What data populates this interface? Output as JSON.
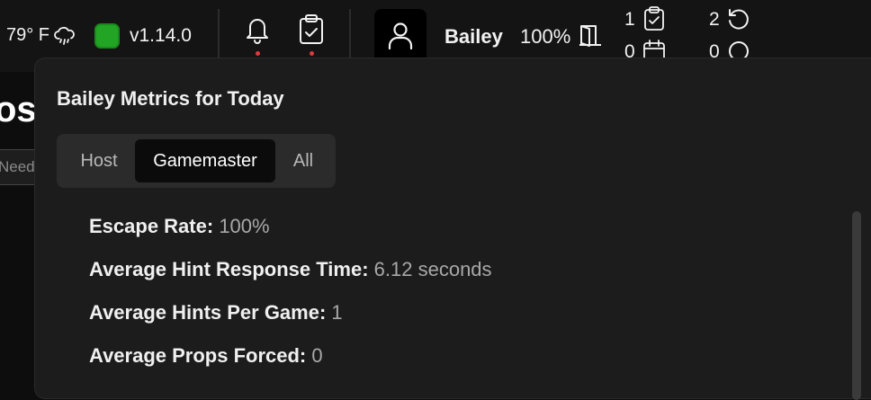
{
  "topbar": {
    "weather": "79° F",
    "weather_icon": "cloud-drizzle-icon",
    "status_color": "#22a524",
    "version": "v1.14.0",
    "username": "Bailey",
    "percent": "100%",
    "stats": {
      "checklist_count": "1",
      "calendar_count": "0",
      "reset_count": "2",
      "circle_count": "0"
    }
  },
  "background": {
    "title_fragment": "ost",
    "field_fragment": "Need"
  },
  "panel": {
    "title": "Bailey Metrics for Today",
    "tabs": [
      {
        "label": "Host",
        "active": false
      },
      {
        "label": "Gamemaster",
        "active": true
      },
      {
        "label": "All",
        "active": false
      }
    ],
    "metrics": [
      {
        "label": "Escape Rate:",
        "value": "100%"
      },
      {
        "label": "Average Hint Response Time:",
        "value": "6.12 seconds"
      },
      {
        "label": "Average Hints Per Game:",
        "value": "1"
      },
      {
        "label": "Average Props Forced:",
        "value": "0"
      }
    ]
  }
}
